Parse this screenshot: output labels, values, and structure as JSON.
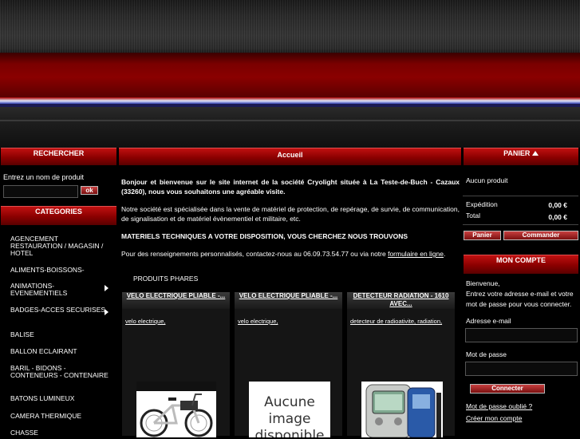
{
  "search": {
    "title": "RECHERCHER",
    "label": "Entrez un nom de produit",
    "ok": "ok"
  },
  "categories": {
    "title": "CATEGORIES",
    "items": [
      {
        "label": "AGENCEMENT RESTAURATION / MAGASIN / HOTEL",
        "submenu": false
      },
      {
        "label": "ALIMENTS-BOISSONS-",
        "submenu": false
      },
      {
        "label": "ANIMATIONS-EVENEMENTIELS",
        "submenu": true
      },
      {
        "label": "BADGES-ACCES SECURISES",
        "submenu": true
      },
      {
        "label": "BALISE",
        "submenu": false
      },
      {
        "label": "BALLON ECLAIRANT",
        "submenu": false
      },
      {
        "label": "BARIL - BIDONS - CONTENEURS - CONTENAIRE",
        "submenu": false
      },
      {
        "label": "BATONS LUMINEUX",
        "submenu": false
      },
      {
        "label": "CAMERA THERMIQUE",
        "submenu": false
      },
      {
        "label": "CHASSE",
        "submenu": false
      }
    ]
  },
  "main": {
    "title": "Accueil",
    "welcome": "Bonjour et bienvenue sur le site internet de la société Cryolight située à La Teste-de-Buch - Cazaux (33260), nous vous souhaitons une agréable visite.",
    "description": "Notre société est spécialisée dans la vente de matériel de protection, de repérage, de survie, de communication, de signalisation et de matériel évènementiel et militaire, etc.",
    "headline": "MATERIELS TECHNIQUES A VOTRE DISPOSITION, VOUS CHERCHEZ NOUS TROUVONS",
    "contact_text": "Pour des renseignements personnalisés, contactez-nous au 06.09.73.54.77 ou via notre ",
    "contact_link": "formulaire en ligne",
    "contact_end": ".",
    "featured_title": "PRODUITS PHARES",
    "products": [
      {
        "title": "VELO ELECTRIQUE PLIABLE -...",
        "desc": "velo electrique,",
        "image": "bike"
      },
      {
        "title": "VELO ELECTRIQUE PLIABLE -...",
        "desc": "velo electrique,",
        "image": "none",
        "image_text": "Aucune image disponible"
      },
      {
        "title": "DETECTEUR RADIATION - 1610 AVEC...",
        "desc": "detecteur de radioativite, radiation,",
        "image": "detector"
      }
    ]
  },
  "cart": {
    "title": "PANIER",
    "empty": "Aucun produit",
    "shipping_label": "Expédition",
    "shipping_value": "0,00 €",
    "total_label": "Total",
    "total_value": "0,00 €",
    "cart_button": "Panier",
    "order_button": "Commander"
  },
  "account": {
    "title": "MON COMPTE",
    "welcome": "Bienvenue,",
    "instructions": "Entrez votre adresse e-mail et votre mot de passe pour vous connecter.",
    "email_label": "Adresse e-mail",
    "password_label": "Mot de passe",
    "login_button": "Connecter",
    "forgot_link": "Mot de passe oublié ?",
    "create_link": "Créer mon compte"
  }
}
